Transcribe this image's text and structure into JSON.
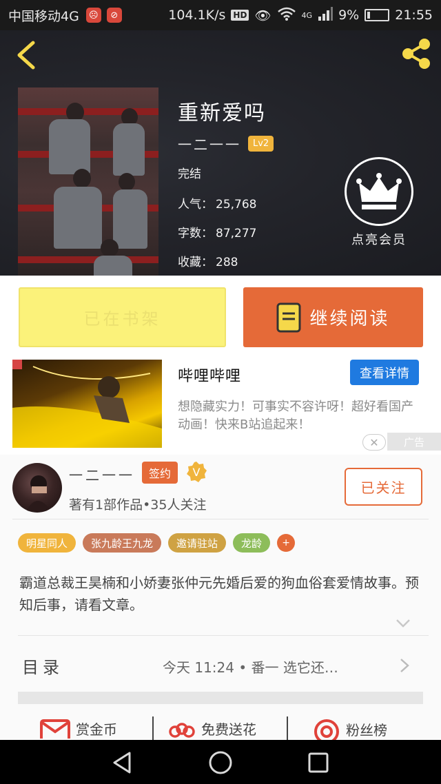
{
  "status_bar": {
    "carrier": "中国移动4G",
    "speed": "104.1K/s",
    "hd": "HD",
    "network": "4G",
    "battery": "9%",
    "time": "21:55"
  },
  "book": {
    "title": "重新爱吗",
    "author": "一二一一",
    "level": "Lv2",
    "status": "完结",
    "popularity_label": "人气：",
    "popularity": "25,768",
    "words_label": "字数：",
    "words": "87,277",
    "favorites_label": "收藏：",
    "favorites": "288",
    "vip_label": "点亮会员"
  },
  "actions": {
    "shelf": "已在书架",
    "read": "继续阅读"
  },
  "ad": {
    "title": "哔哩哔哩",
    "button": "查看详情",
    "description": "想隐藏实力！可事实不容许呀！超好看国产动画！快来B站追起来！",
    "tag": "广告"
  },
  "author_info": {
    "name": "一二一一",
    "sign_badge": "签约",
    "stats": "著有1部作品•35人关注",
    "follow": "已关注"
  },
  "tags": [
    {
      "label": "明星同人",
      "color": "#f0b43c"
    },
    {
      "label": "张九龄王九龙",
      "color": "#c97a5a"
    },
    {
      "label": "邀请驻站",
      "color": "#cfa243"
    },
    {
      "label": "龙龄",
      "color": "#8dbd5a"
    }
  ],
  "synopsis": "霸道总裁王昊楠和小娇妻张仲元先婚后爱的狗血俗套爱情故事。预知后事，请看文章。",
  "toc": {
    "label": "目录",
    "latest": "今天 11:24 • 番一 选它还…"
  },
  "bottom_actions": {
    "reward": "赏金币",
    "flower": "免费送花",
    "fans": "粉丝榜"
  },
  "colors": {
    "accent": "#e56a38",
    "shelf_button": "#fbf27a",
    "ad_button": "#1f7ae0",
    "level_badge": "#f0b43c"
  }
}
